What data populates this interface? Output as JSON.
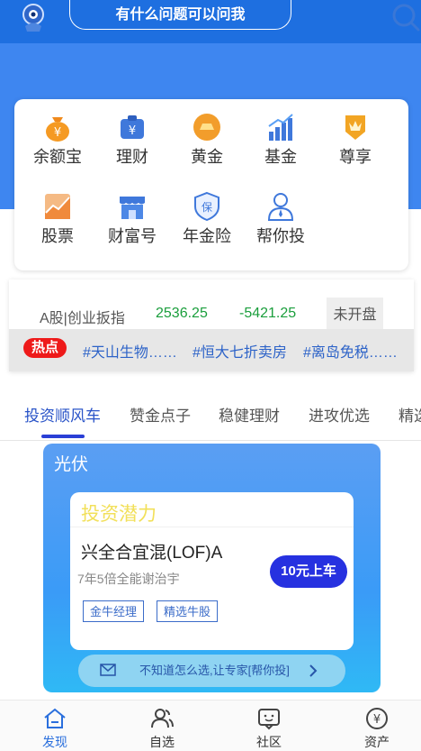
{
  "header": {
    "search_placeholder": "有什么问题可以问我"
  },
  "grid": {
    "items": [
      {
        "label": "余额宝",
        "icon": "money-bag-icon"
      },
      {
        "label": "理财",
        "icon": "wallet-icon"
      },
      {
        "label": "黄金",
        "icon": "gold-icon"
      },
      {
        "label": "基金",
        "icon": "chart-bars-icon"
      },
      {
        "label": "尊享",
        "icon": "crown-badge-icon"
      },
      {
        "label": "股票",
        "icon": "stock-trend-icon"
      },
      {
        "label": "财富号",
        "icon": "store-icon"
      },
      {
        "label": "年金险",
        "icon": "shield-icon"
      },
      {
        "label": "帮你投",
        "icon": "advisor-icon"
      }
    ]
  },
  "market": {
    "name": "A股|创业扳指",
    "value1": "2536.25",
    "value2": "-5421.25",
    "status": "未开盘",
    "hot_badge": "热点",
    "hot_tags": [
      "#天山生物……",
      "#恒大七折卖房",
      "#离岛免税……"
    ]
  },
  "tabs": [
    "投资顺风车",
    "赞金点子",
    "稳健理财",
    "进攻优选",
    "精选"
  ],
  "panel": {
    "title": "光伏",
    "tag": "投资潜力",
    "fund_name": "兴全合宜混(LOF)A",
    "fund_desc": "7年5倍全能谢治宇",
    "cta": "10元上车",
    "chips": [
      "金牛经理",
      "精选牛股"
    ],
    "advice": "不知道怎么选,让专家[帮你投]"
  },
  "bottom_nav": [
    {
      "label": "发现",
      "icon": "home-icon",
      "active": true
    },
    {
      "label": "自选",
      "icon": "people-icon",
      "active": false
    },
    {
      "label": "社区",
      "icon": "chat-icon",
      "active": false
    },
    {
      "label": "资产",
      "icon": "yen-icon",
      "active": false
    }
  ],
  "colors": {
    "primary": "#1e6fe0",
    "accent": "#2631e0",
    "up": "#1a9e3c",
    "hot": "#ee1a1a"
  }
}
